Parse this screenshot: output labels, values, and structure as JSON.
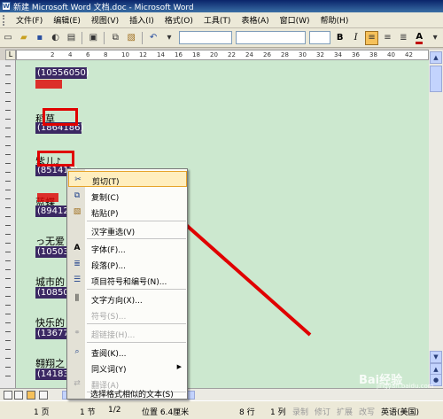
{
  "window": {
    "title": "新建 Microsoft Word 文档.doc - Microsoft Word"
  },
  "menubar": {
    "items": [
      {
        "label": "文件(F)"
      },
      {
        "label": "编辑(E)"
      },
      {
        "label": "视图(V)"
      },
      {
        "label": "插入(I)"
      },
      {
        "label": "格式(O)"
      },
      {
        "label": "工具(T)"
      },
      {
        "label": "表格(A)"
      },
      {
        "label": "窗口(W)"
      },
      {
        "label": "帮助(H)"
      }
    ]
  },
  "toolbar": {
    "bold_label": "B",
    "italic_label": "I",
    "font_color_label": "A"
  },
  "ruler": {
    "ticks": [
      "2",
      "4",
      "6",
      "8",
      "10",
      "12",
      "14",
      "16",
      "18",
      "20",
      "22",
      "24",
      "26",
      "28",
      "30",
      "32",
      "34",
      "36",
      "38",
      "40",
      "42"
    ]
  },
  "document": {
    "lines": [
      {
        "code": "(10556050)",
        "label": "秋秋"
      },
      {
        "code": "(1864186)",
        "label": "稻草"
      },
      {
        "code": "(851412)",
        "label": "紫儿♪"
      },
      {
        "code": "(894125)",
        "label": "蓝蝶"
      },
      {
        "text": "っ无爱",
        "code": "(105036"
      },
      {
        "text": "城市的",
        "code": "(108501"
      },
      {
        "text": "快乐的",
        "code": "(136777"
      },
      {
        "text": "翱翔之",
        "code": "(141836"
      }
    ]
  },
  "context_menu": {
    "items": [
      {
        "label": "剪切(T)",
        "icon": "scissors-icon",
        "enabled": true,
        "highlighted": true
      },
      {
        "label": "复制(C)",
        "icon": "copy-icon",
        "enabled": true
      },
      {
        "label": "粘贴(P)",
        "icon": "paste-icon",
        "enabled": true
      },
      {
        "label": "汉字重选(V)",
        "icon": "",
        "enabled": true
      },
      {
        "label": "字体(F)...",
        "icon": "font-icon",
        "enabled": true
      },
      {
        "label": "段落(P)...",
        "icon": "paragraph-icon",
        "enabled": true
      },
      {
        "label": "项目符号和编号(N)...",
        "icon": "bullets-icon",
        "enabled": true
      },
      {
        "label": "文字方向(X)...",
        "icon": "text-direction-icon",
        "enabled": true
      },
      {
        "label": "符号(S)...",
        "icon": "",
        "enabled": false
      },
      {
        "label": "超链接(H)...",
        "icon": "hyperlink-icon",
        "enabled": false
      },
      {
        "label": "查阅(K)...",
        "icon": "research-icon",
        "enabled": true
      },
      {
        "label": "同义词(Y)",
        "icon": "",
        "enabled": true,
        "submenu": true
      },
      {
        "label": "翻译(A)",
        "icon": "translate-icon",
        "enabled": false
      },
      {
        "label": "选择格式相似的文本(S)",
        "icon": "",
        "enabled": true
      }
    ]
  },
  "statusbar": {
    "page": "1 页",
    "section": "1 节",
    "page_of": "1/2",
    "position": "位置 6.4厘米",
    "line": "8 行",
    "column": "1 列",
    "rec": "录制",
    "trk": "修订",
    "ext": "扩展",
    "ovr": "改写",
    "language": "英语(美国)"
  },
  "watermark": {
    "text": "Bai经验",
    "sub": "jingyan.baidu.com"
  },
  "colors": {
    "doc_bg": "#cce8cf",
    "annotation_red": "#e00000",
    "code_bg": "#3b2863"
  }
}
